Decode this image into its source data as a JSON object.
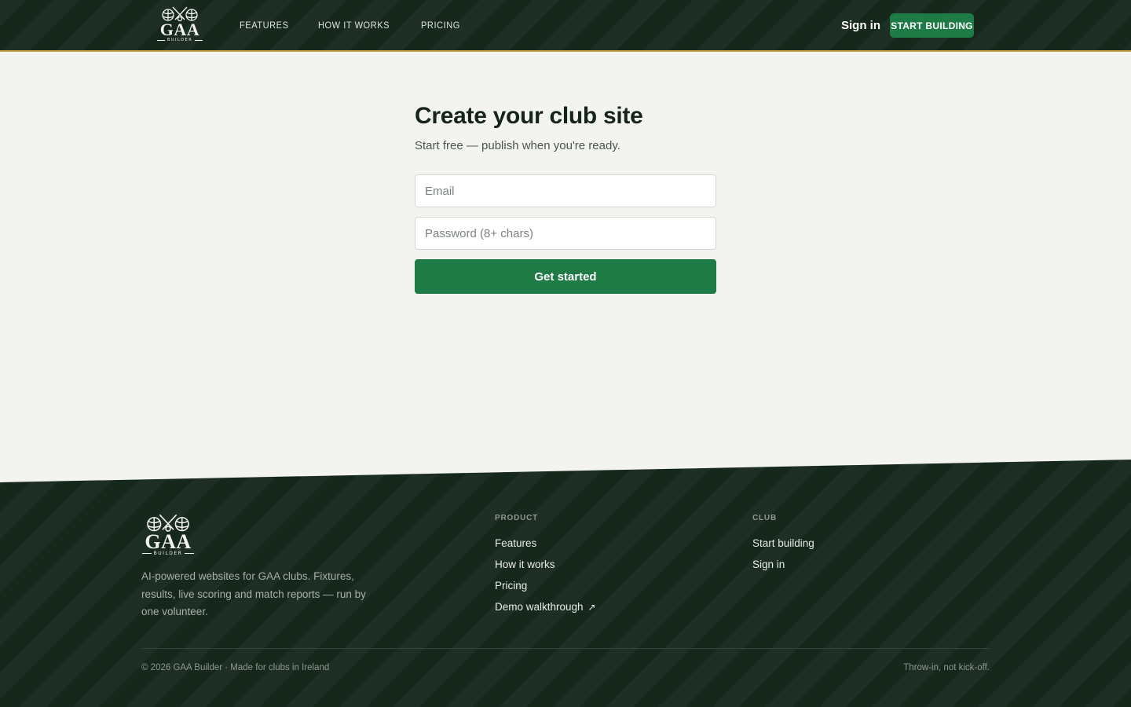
{
  "header": {
    "logo_text": "GAA",
    "logo_subtext": "BUILDER",
    "nav": [
      "FEATURES",
      "HOW IT WORKS",
      "PRICING"
    ],
    "signin_label": "Sign in",
    "cta_label": "START BUILDING"
  },
  "form": {
    "title": "Create your club site",
    "subtitle": "Start free — publish when you're ready.",
    "email_placeholder": "Email",
    "password_placeholder": "Password (8+ chars)",
    "submit_label": "Get started"
  },
  "footer": {
    "logo_text": "GAA",
    "logo_subtext": "BUILDER",
    "description": "AI-powered websites for GAA clubs. Fixtures, results, live scoring and match reports — run by one volunteer.",
    "product": {
      "title": "PRODUCT",
      "links": [
        "Features",
        "How it works",
        "Pricing",
        "Demo walkthrough"
      ],
      "external_glyph": "↗"
    },
    "club": {
      "title": "CLUB",
      "links": [
        "Start building",
        "Sign in"
      ]
    },
    "copyright": "© 2026 GAA Builder · Made for clubs in Ireland",
    "tagline": "Throw-in, not kick-off."
  },
  "colors": {
    "dark_green": "#16271c",
    "accent_green": "#1e7b45",
    "gold_rule": "#c9a64a",
    "page_bg": "#f3f4f0"
  },
  "icons": [
    "crossed-hurleys-crest-icon",
    "external-link-icon"
  ]
}
